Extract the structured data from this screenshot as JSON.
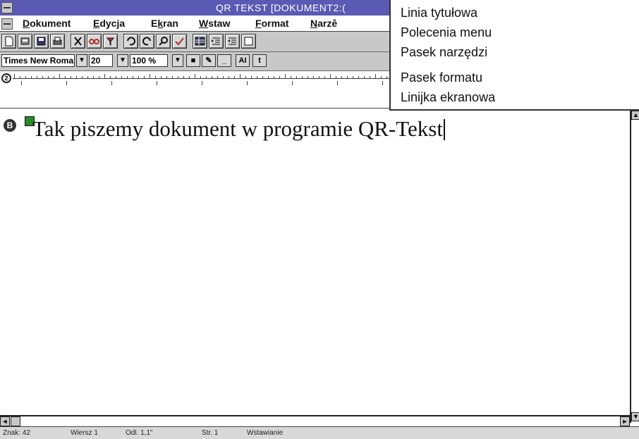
{
  "window": {
    "title": "QR TEKST  [DOKUMENT2:("
  },
  "menu": {
    "items": [
      {
        "label": "Dokument",
        "accel": "D"
      },
      {
        "label": "Edycja",
        "accel": "E"
      },
      {
        "label": "Ekran",
        "accel": "k"
      },
      {
        "label": "Wstaw",
        "accel": "W"
      },
      {
        "label": "Format",
        "accel": "F"
      },
      {
        "label": "Narzê",
        "accel": "N"
      }
    ]
  },
  "format_bar": {
    "font_name": "Times New Roman",
    "font_size": "20",
    "zoom": "100 %",
    "button_a": "AI",
    "button_b": "t"
  },
  "callouts": {
    "title_line": "Linia tytułowa",
    "menu_commands": "Polecenia menu",
    "toolbar": "Pasek narzędzi",
    "format_bar": "Pasek formatu",
    "ruler": "Linijka ekranowa"
  },
  "document": {
    "paragraph_marker": "B",
    "text": "Tak piszemy dokument w programie QR-Tekst"
  },
  "ruler": {
    "marker": "2"
  },
  "status": {
    "chars": "Znak: 42",
    "line": "Wiersz 1",
    "position": "Odl. 1,1\"",
    "page": "Str. 1",
    "mode": "Wstawianie"
  },
  "icons": {
    "toolbar": [
      "new-document-icon",
      "open-icon",
      "save-icon",
      "print-icon",
      "cut-icon",
      "copy-icon",
      "paste-icon",
      "undo-icon",
      "redo-icon",
      "search-icon",
      "spellcheck-icon",
      "table-icon",
      "indent-left-icon",
      "indent-right-icon",
      "frame-icon"
    ]
  }
}
